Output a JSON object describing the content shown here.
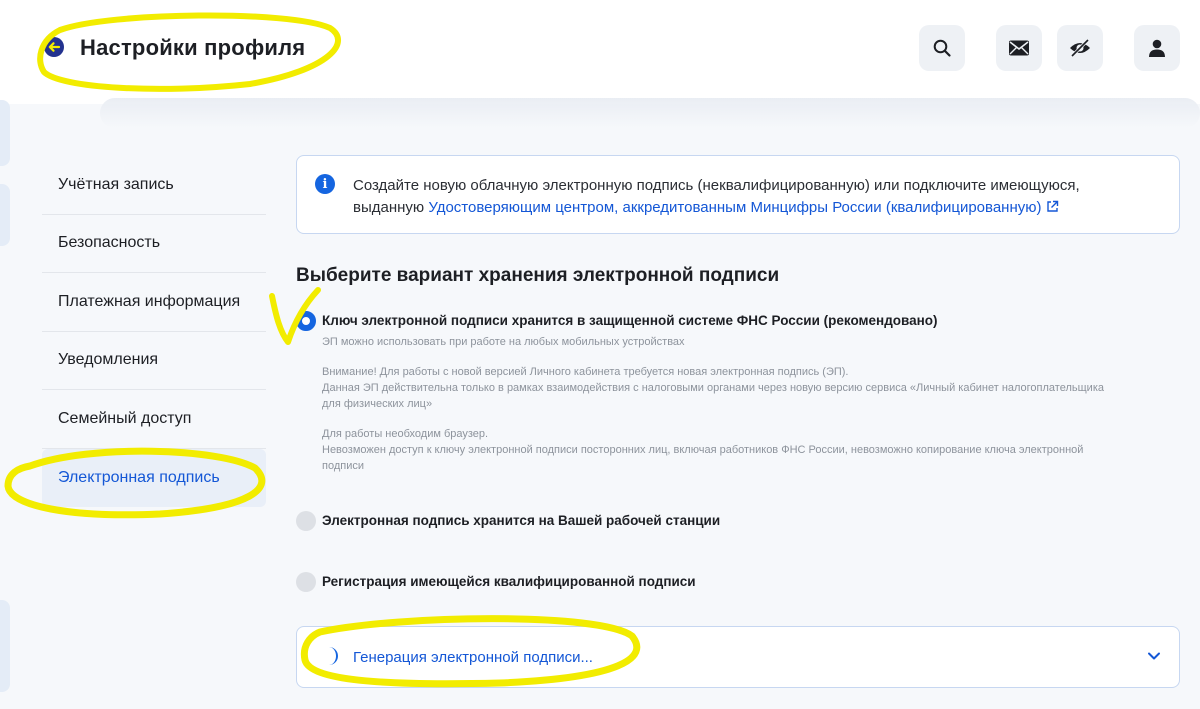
{
  "header": {
    "title": "Настройки профиля",
    "icons": [
      "search-icon",
      "mail-icon",
      "eye-off-icon",
      "user-icon"
    ]
  },
  "sidebar": {
    "items": [
      {
        "label": "Учётная запись"
      },
      {
        "label": "Безопасность"
      },
      {
        "label": "Платежная информация"
      },
      {
        "label": "Уведомления"
      },
      {
        "label": "Семейный доступ"
      },
      {
        "label": "Электронная подпись",
        "active": true
      }
    ]
  },
  "info": {
    "text_line1": "Создайте новую облачную электронную подпись (неквалифицированную) или подключите имеющуюся,",
    "text_prefix": "выданную",
    "link": "Удостоверяющим центром, аккредитованным Минцифры России (квалифицированную)"
  },
  "section": {
    "title": "Выберите вариант хранения электронной подписи"
  },
  "options": [
    {
      "label": "Ключ электронной подписи хранится в защищенной системе ФНС России (рекомендовано)",
      "selected": true,
      "desc1": "ЭП можно использовать при работе на любых мобильных устройствах",
      "desc2_l1": "Внимание! Для работы с новой версией Личного кабинета требуется новая электронная подпись (ЭП).",
      "desc2_l2": "Данная ЭП действительна только в рамках взаимодействия с налоговыми органами через новую версию сервиса «Личный кабинет налогоплательщика",
      "desc2_l3": "для физических лиц»",
      "desc3_l1": "Для работы необходим браузер.",
      "desc3_l2": "Невозможен доступ к ключу электронной подписи посторонних лиц, включая работников ФНС России, невозможно копирование ключа электронной",
      "desc3_l3": "подписи"
    },
    {
      "label": "Электронная подпись хранится на Вашей рабочей станции",
      "selected": false
    },
    {
      "label": "Регистрация имеющейся квалифицированной подписи",
      "selected": false
    }
  ],
  "generation": {
    "label": "Генерация электронной подписи..."
  },
  "colors": {
    "accent": "#1565e0",
    "link": "#1457d6",
    "highlighter": "#f2ec00"
  }
}
